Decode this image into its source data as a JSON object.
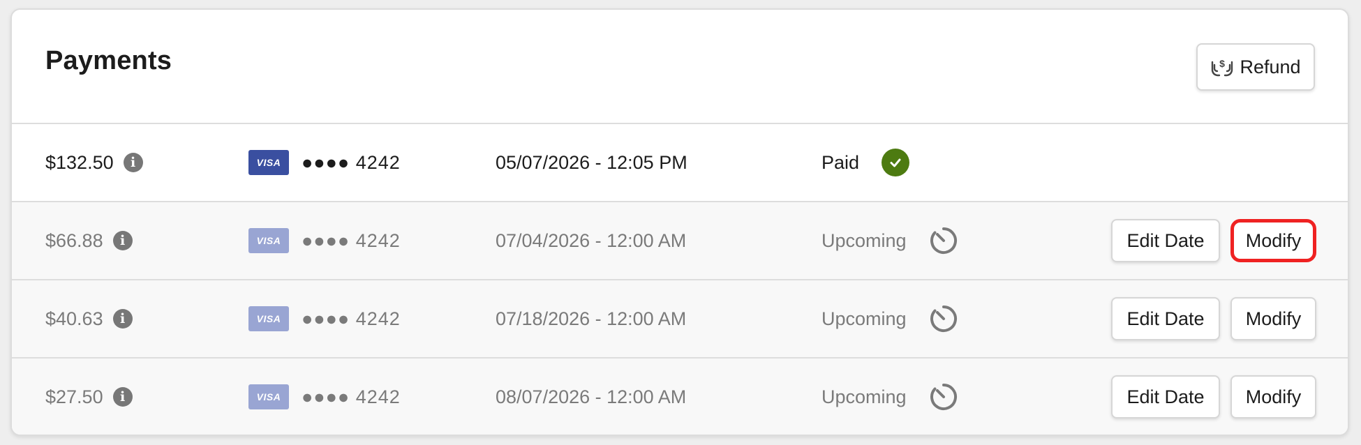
{
  "header": {
    "title": "Payments",
    "refund_label": "Refund"
  },
  "actions": {
    "edit_date_label": "Edit Date",
    "modify_label": "Modify"
  },
  "payments": [
    {
      "amount": "$132.50",
      "card_brand": "VISA",
      "card_mask": "●●●● 4242",
      "datetime": "05/07/2026 - 12:05 PM",
      "status": "Paid",
      "status_icon": "check-circle-icon"
    },
    {
      "amount": "$66.88",
      "card_brand": "VISA",
      "card_mask": "●●●● 4242",
      "datetime": "07/04/2026 - 12:00 AM",
      "status": "Upcoming",
      "status_icon": "timer-icon"
    },
    {
      "amount": "$40.63",
      "card_brand": "VISA",
      "card_mask": "●●●● 4242",
      "datetime": "07/18/2026 - 12:00 AM",
      "status": "Upcoming",
      "status_icon": "timer-icon"
    },
    {
      "amount": "$27.50",
      "card_brand": "VISA",
      "card_mask": "●●●● 4242",
      "datetime": "08/07/2026 - 12:00 AM",
      "status": "Upcoming",
      "status_icon": "timer-icon"
    }
  ],
  "colors": {
    "paid_check": "#4d7b11",
    "visa_active": "#3a4fa0",
    "visa_faded": "#99a5d3",
    "highlight_outline": "#ef2222",
    "muted_text": "#7a7a7a"
  }
}
